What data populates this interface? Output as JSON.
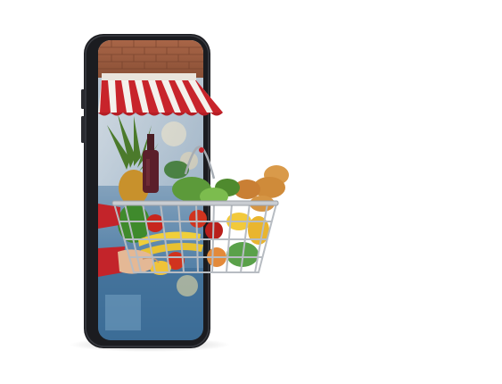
{
  "scene": {
    "description_icon": "online-grocery-phone-illustration",
    "colors": {
      "background": "#ffffff",
      "phone_body": "#1b1c20",
      "phone_edge": "#3a3c42",
      "brick": "#9b5d3f",
      "awning_red": "#c8242b",
      "awning_white": "#f4f1ec",
      "screen_sky": "#7fa0bd",
      "screen_floor": "#3d6d95",
      "basket_wire": "#b7bcc2",
      "sleeve": "#c3242a",
      "hand": "#e4b895"
    }
  }
}
